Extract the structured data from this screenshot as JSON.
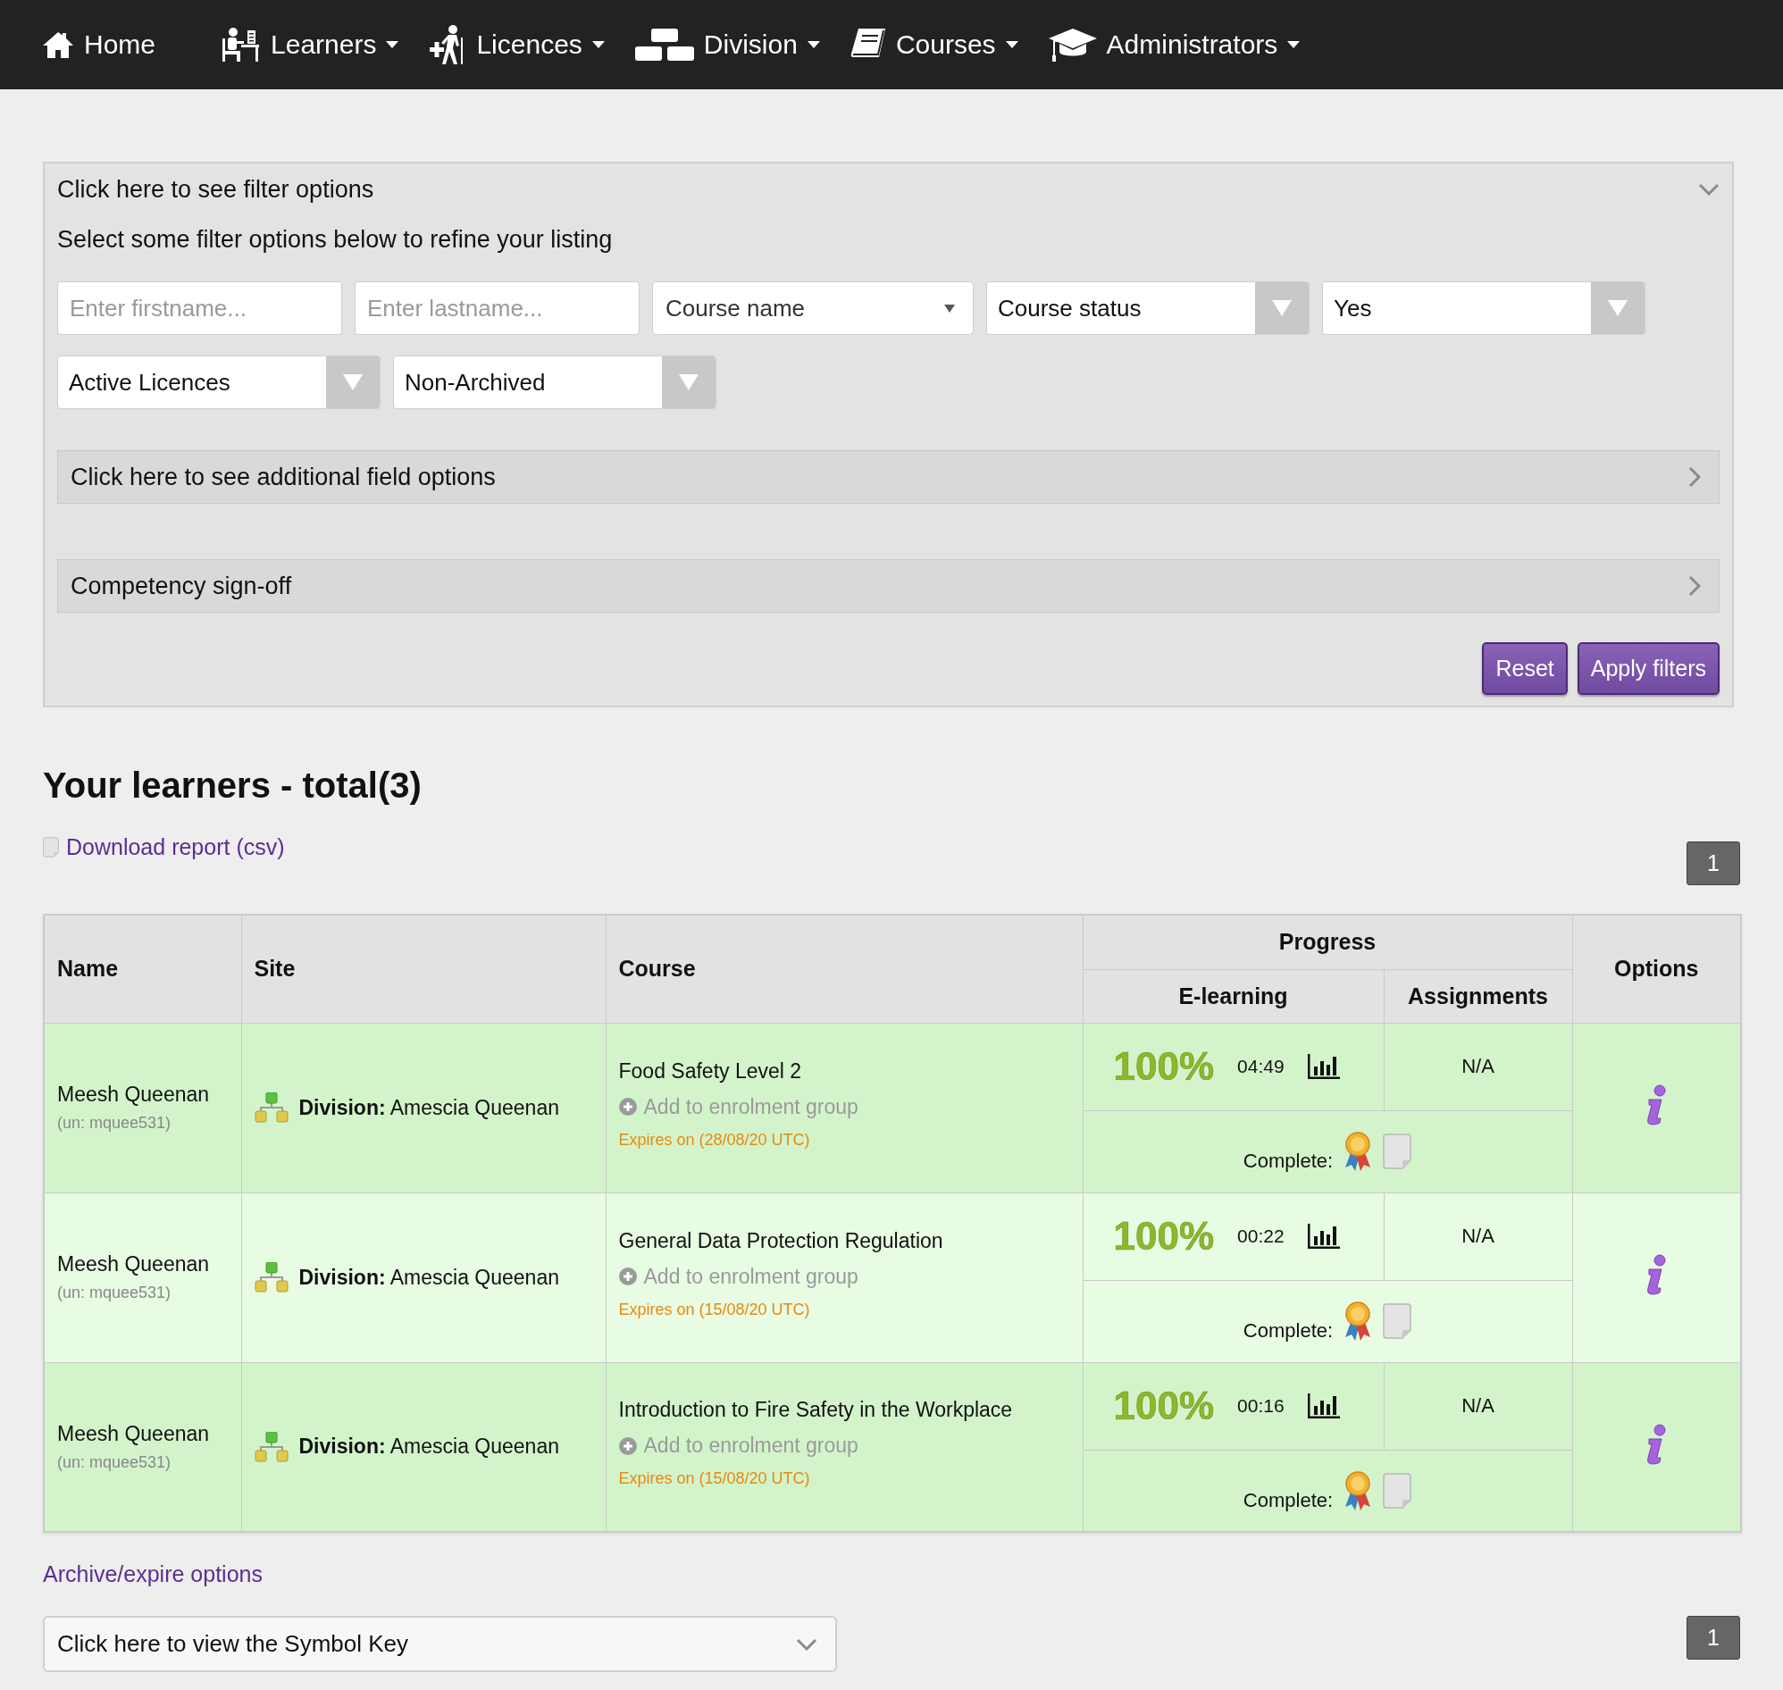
{
  "nav": {
    "items": [
      {
        "label": "Home",
        "has_menu": false
      },
      {
        "label": "Learners",
        "has_menu": true
      },
      {
        "label": "Licences",
        "has_menu": true
      },
      {
        "label": "Division",
        "has_menu": true
      },
      {
        "label": "Courses",
        "has_menu": true
      },
      {
        "label": "Administrators",
        "has_menu": true
      }
    ]
  },
  "filter_panel": {
    "title": "Click here to see filter options",
    "expanded": true,
    "instructions": "Select some filter options below to refine your listing",
    "fields": [
      {
        "kind": "text",
        "placeholder": "Enter firstname..."
      },
      {
        "kind": "text",
        "placeholder": "Enter lastname..."
      },
      {
        "kind": "combo",
        "value": "Course name"
      },
      {
        "kind": "select",
        "value": "Course status"
      },
      {
        "kind": "select",
        "value": "Yes"
      },
      {
        "kind": "select",
        "value": "Active Licences"
      },
      {
        "kind": "select",
        "value": "Non-Archived"
      }
    ],
    "sections": [
      {
        "label": "Click here to see additional field options",
        "expanded": false
      },
      {
        "label": "Competency sign-off",
        "expanded": false
      }
    ],
    "buttons": [
      "Reset",
      "Apply filters"
    ]
  },
  "learners": {
    "heading": "Your learners - total(3)",
    "download_link": "Download report (csv)",
    "pagination_top": [
      {
        "label": "1",
        "selected": true
      }
    ],
    "table": {
      "columns": {
        "name": "Name",
        "site": "Site",
        "course": "Course",
        "progress": "Progress",
        "e_learning": "E-learning",
        "assignments": "Assignments",
        "options": "Options"
      },
      "rows": [
        {
          "name": "Meesh Queenan",
          "username": "(un: mquee531)",
          "site": "**Division:** Amescia Queenan",
          "course": "Food Safety Level 2",
          "enrol_link": "Add to enrolment group",
          "expiry": "Expires on (28/08/20 UTC)",
          "e_learning": "100%",
          "time": "04:49",
          "assignments": "N/A",
          "status": "Complete:"
        },
        {
          "name": "Meesh Queenan",
          "username": "(un: mquee531)",
          "site": "**Division:** Amescia Queenan",
          "course": "General Data Protection Regulation",
          "enrol_link": "Add to enrolment group",
          "expiry": "Expires on (15/08/20 UTC)",
          "e_learning": "100%",
          "time": "00:22",
          "assignments": "N/A",
          "status": "Complete:"
        },
        {
          "name": "Meesh Queenan",
          "username": "(un: mquee531)",
          "site": "**Division:** Amescia Queenan",
          "course": "Introduction to Fire Safety in the Workplace",
          "enrol_link": "Add to enrolment group",
          "expiry": "Expires on (15/08/20 UTC)",
          "e_learning": "100%",
          "time": "00:16",
          "assignments": "N/A",
          "status": "Complete:"
        }
      ]
    },
    "archive_link": "Archive/expire options",
    "symbol_key": {
      "label": "Click here to view the Symbol Key",
      "expanded": false
    },
    "pagination_bottom": [
      {
        "label": "1",
        "selected": true
      }
    ]
  }
}
